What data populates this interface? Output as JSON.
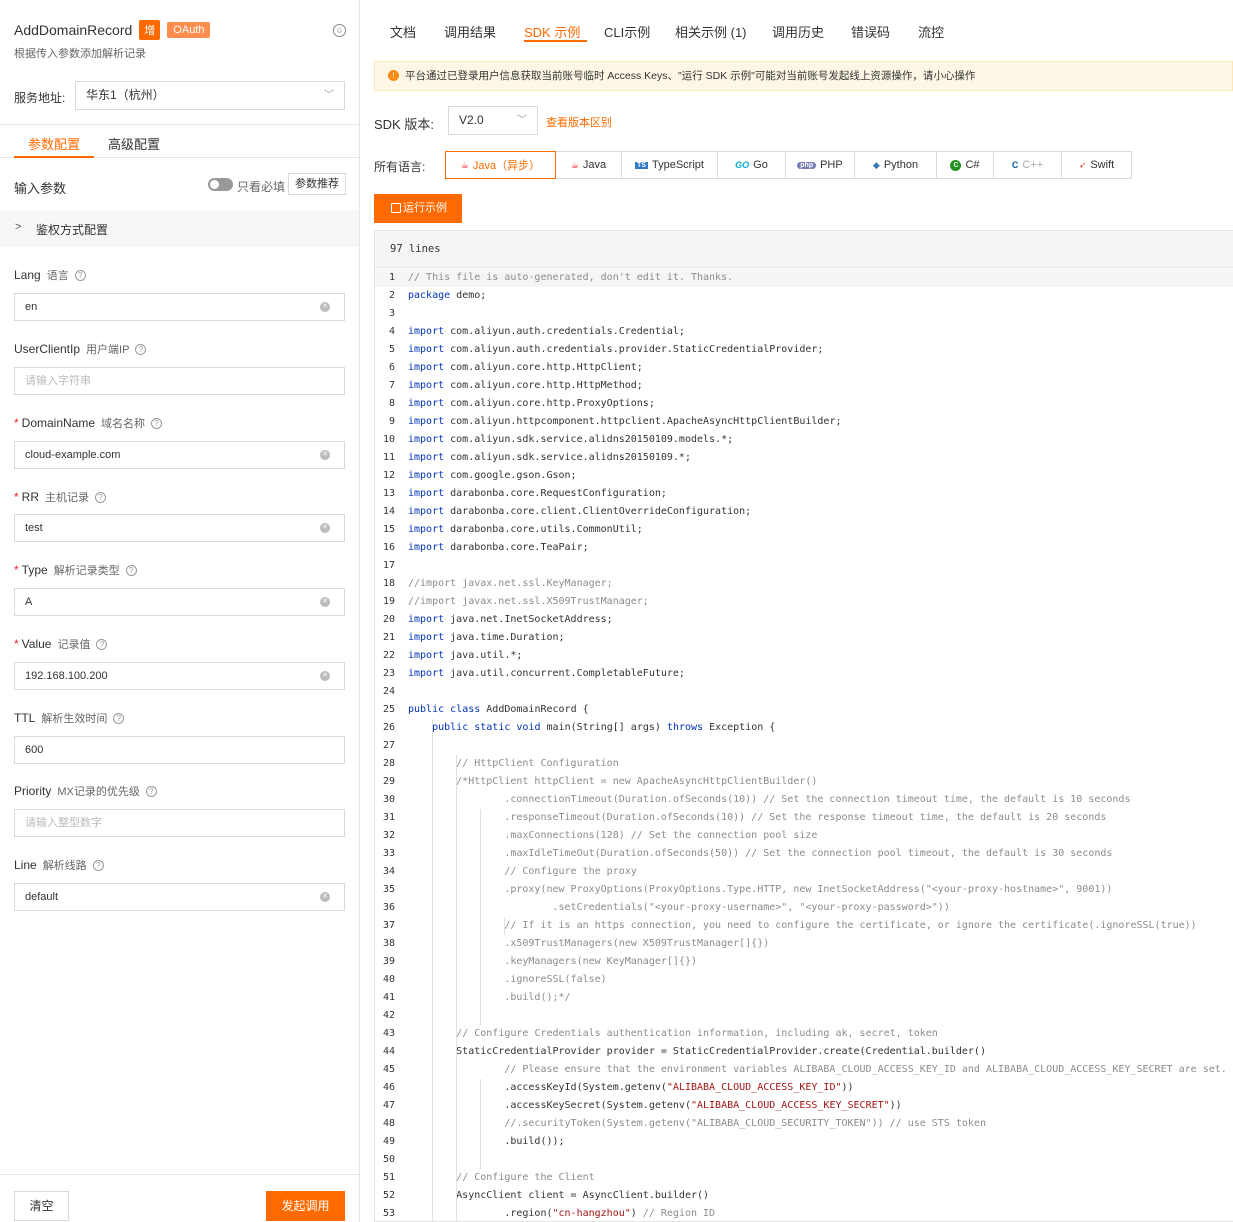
{
  "api": {
    "name": "AddDomainRecord",
    "badge_write": "增",
    "badge_oauth": "OAuth",
    "description": "根据传入参数添加解析记录"
  },
  "service": {
    "label": "服务地址:",
    "value": "华东1（杭州）"
  },
  "left_tabs": {
    "params": "参数配置",
    "advanced": "高级配置"
  },
  "input_params": {
    "title": "输入参数",
    "only_required": "只看必填",
    "recommend": "参数推荐"
  },
  "auth_section": {
    "label": "鉴权方式配置"
  },
  "fields": [
    {
      "name": "Lang",
      "cn": "语言",
      "required": false,
      "value": "en",
      "placeholder": ""
    },
    {
      "name": "UserClientIp",
      "cn": "用户端IP",
      "required": false,
      "value": "",
      "placeholder": "请输入字符串"
    },
    {
      "name": "DomainName",
      "cn": "域名名称",
      "required": true,
      "value": "cloud-example.com",
      "placeholder": ""
    },
    {
      "name": "RR",
      "cn": "主机记录",
      "required": true,
      "value": "test",
      "placeholder": ""
    },
    {
      "name": "Type",
      "cn": "解析记录类型",
      "required": true,
      "value": "A",
      "placeholder": ""
    },
    {
      "name": "Value",
      "cn": "记录值",
      "required": true,
      "value": "192.168.100.200",
      "placeholder": ""
    },
    {
      "name": "TTL",
      "cn": "解析生效时间",
      "required": false,
      "value": "600",
      "placeholder": ""
    },
    {
      "name": "Priority",
      "cn": "MX记录的优先级",
      "required": false,
      "value": "",
      "placeholder": "请输入整型数字"
    },
    {
      "name": "Line",
      "cn": "解析线路",
      "required": false,
      "value": "default",
      "placeholder": ""
    }
  ],
  "actions": {
    "clear": "清空",
    "call": "发起调用"
  },
  "right_tabs": [
    "文档",
    "调用结果",
    "SDK 示例",
    "CLI示例",
    "相关示例 (1)",
    "调用历史",
    "错误码",
    "流控"
  ],
  "active_right_tab": "SDK 示例",
  "notice": "平台通过已登录用户信息获取当前账号临时 Access Keys、\"运行 SDK 示例\"可能对当前账号发起线上资源操作，请小心操作",
  "sdk": {
    "version_label": "SDK 版本:",
    "version": "V2.0",
    "diff_link": "查看版本区别"
  },
  "languages": {
    "label": "所有语言:",
    "items": [
      {
        "label": "Java（异步）",
        "icon": "java-icon",
        "active": true
      },
      {
        "label": "Java",
        "icon": "java-icon",
        "active": false
      },
      {
        "label": "TypeScript",
        "icon": "typescript-icon",
        "active": false
      },
      {
        "label": "Go",
        "icon": "go-icon",
        "active": false
      },
      {
        "label": "PHP",
        "icon": "php-icon",
        "active": false
      },
      {
        "label": "Python",
        "icon": "python-icon",
        "active": false
      },
      {
        "label": "C#",
        "icon": "csharp-icon",
        "active": false
      },
      {
        "label": "C++",
        "icon": "cpp-icon",
        "active": false
      },
      {
        "label": "Swift",
        "icon": "swift-icon",
        "active": false
      }
    ]
  },
  "run_button": "运行示例",
  "code": {
    "line_count": "97 lines",
    "lines": [
      "// This file is auto-generated, don't edit it. Thanks.",
      "package demo;",
      "",
      "import com.aliyun.auth.credentials.Credential;",
      "import com.aliyun.auth.credentials.provider.StaticCredentialProvider;",
      "import com.aliyun.core.http.HttpClient;",
      "import com.aliyun.core.http.HttpMethod;",
      "import com.aliyun.core.http.ProxyOptions;",
      "import com.aliyun.httpcomponent.httpclient.ApacheAsyncHttpClientBuilder;",
      "import com.aliyun.sdk.service.alidns20150109.models.*;",
      "import com.aliyun.sdk.service.alidns20150109.*;",
      "import com.google.gson.Gson;",
      "import darabonba.core.RequestConfiguration;",
      "import darabonba.core.client.ClientOverrideConfiguration;",
      "import darabonba.core.utils.CommonUtil;",
      "import darabonba.core.TeaPair;",
      "",
      "//import javax.net.ssl.KeyManager;",
      "//import javax.net.ssl.X509TrustManager;",
      "import java.net.InetSocketAddress;",
      "import java.time.Duration;",
      "import java.util.*;",
      "import java.util.concurrent.CompletableFuture;",
      "",
      "public class AddDomainRecord {",
      "    public static void main(String[] args) throws Exception {",
      "",
      "        // HttpClient Configuration",
      "        /*HttpClient httpClient = new ApacheAsyncHttpClientBuilder()",
      "                .connectionTimeout(Duration.ofSeconds(10)) // Set the connection timeout time, the default is 10 seconds",
      "                .responseTimeout(Duration.ofSeconds(10)) // Set the response timeout time, the default is 20 seconds",
      "                .maxConnections(128) // Set the connection pool size",
      "                .maxIdleTimeOut(Duration.ofSeconds(50)) // Set the connection pool timeout, the default is 30 seconds",
      "                // Configure the proxy",
      "                .proxy(new ProxyOptions(ProxyOptions.Type.HTTP, new InetSocketAddress(\"<your-proxy-hostname>\", 9001))",
      "                        .setCredentials(\"<your-proxy-username>\", \"<your-proxy-password>\"))",
      "                // If it is an https connection, you need to configure the certificate, or ignore the certificate(.ignoreSSL(true))",
      "                .x509TrustManagers(new X509TrustManager[]{})",
      "                .keyManagers(new KeyManager[]{})",
      "                .ignoreSSL(false)",
      "                .build();*/",
      "",
      "        // Configure Credentials authentication information, including ak, secret, token",
      "        StaticCredentialProvider provider = StaticCredentialProvider.create(Credential.builder()",
      "                // Please ensure that the environment variables ALIBABA_CLOUD_ACCESS_KEY_ID and ALIBABA_CLOUD_ACCESS_KEY_SECRET are set.",
      "                .accessKeyId(System.getenv(\"ALIBABA_CLOUD_ACCESS_KEY_ID\"))",
      "                .accessKeySecret(System.getenv(\"ALIBABA_CLOUD_ACCESS_KEY_SECRET\"))",
      "                //.securityToken(System.getenv(\"ALIBABA_CLOUD_SECURITY_TOKEN\")) // use STS token",
      "                .build());",
      "",
      "        // Configure the Client",
      "        AsyncClient client = AsyncClient.builder()",
      "                .region(\"cn-hangzhou\") // Region ID"
    ]
  }
}
